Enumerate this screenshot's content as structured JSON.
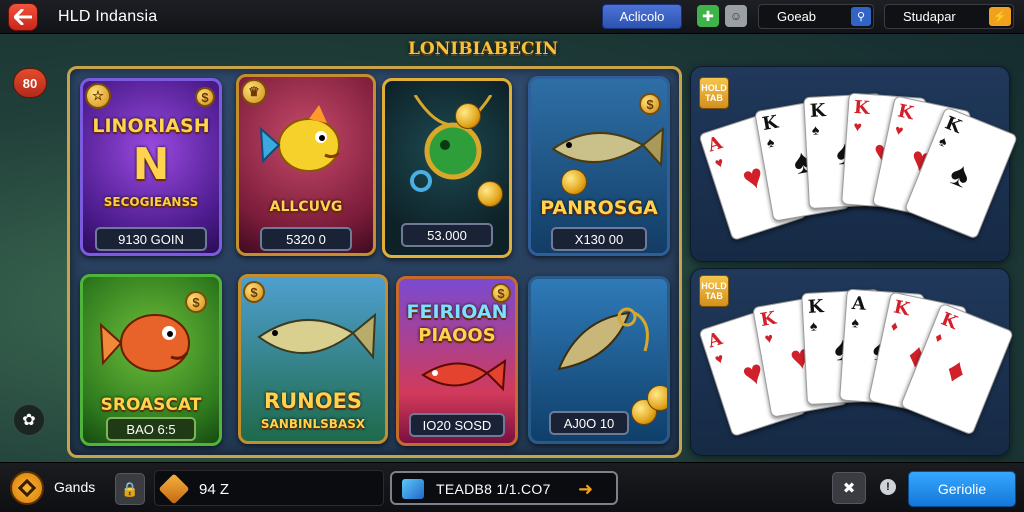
{
  "header": {
    "title": "HLD Indansia",
    "primary_button": "Aclicolo",
    "search_value": "Goeab",
    "location_value": "Studapar"
  },
  "side": {
    "badge_label": "80"
  },
  "banner": {
    "title": "LONIBIABECIN"
  },
  "games": [
    {
      "title_top": "LINORIASH",
      "title_mid": "N",
      "subtitle": "SECOGIEANSS",
      "price": "9130 GOIN"
    },
    {
      "title_top": "",
      "title_mid": "",
      "subtitle": "ALLCUVG",
      "price": "5320 0"
    },
    {
      "title_top": "",
      "title_mid": "",
      "subtitle": "",
      "price": "53.000"
    },
    {
      "title_top": "",
      "title_mid": "",
      "subtitle": "PANROSGA",
      "price": "X130 00"
    },
    {
      "title_top": "",
      "title_mid": "",
      "subtitle": "SROASCAT",
      "price": "BAO 6:5"
    },
    {
      "title_top": "",
      "title_mid": "RUNOES",
      "subtitle": "SANBINLSBASX",
      "price": ""
    },
    {
      "title_top": "FEIRIOAN",
      "title_mid": "PIAOOS",
      "subtitle": "",
      "price": "IO20 SOSD"
    },
    {
      "title_top": "",
      "title_mid": "",
      "subtitle": "",
      "price": "AJ0O 10"
    }
  ],
  "card_panels": [
    {
      "chip_label": "HOLD TAB",
      "cards": [
        {
          "rank": "A",
          "suit": "♥",
          "color": "red"
        },
        {
          "rank": "K",
          "suit": "♠",
          "color": "black"
        },
        {
          "rank": "K",
          "suit": "♠",
          "color": "black"
        },
        {
          "rank": "K",
          "suit": "♥",
          "color": "red"
        },
        {
          "rank": "K",
          "suit": "♥",
          "color": "red"
        },
        {
          "rank": "K",
          "suit": "♠",
          "color": "black"
        }
      ]
    },
    {
      "chip_label": "HOLD TAB",
      "cards": [
        {
          "rank": "A",
          "suit": "♥",
          "color": "red"
        },
        {
          "rank": "K",
          "suit": "♥",
          "color": "red"
        },
        {
          "rank": "K",
          "suit": "♠",
          "color": "black"
        },
        {
          "rank": "A",
          "suit": "♠",
          "color": "black"
        },
        {
          "rank": "K",
          "suit": "♦",
          "color": "red"
        },
        {
          "rank": "K",
          "suit": "♦",
          "color": "red"
        }
      ]
    }
  ],
  "footer": {
    "label": "Gands",
    "balance": "94 Z",
    "promo_text": "TEADB8 1/1.CO7",
    "continue_label": "Geriolie"
  }
}
